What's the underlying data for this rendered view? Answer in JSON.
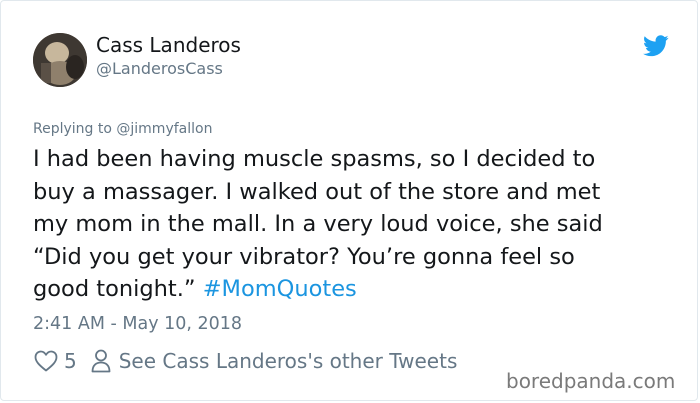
{
  "tweet": {
    "user": {
      "display_name": "Cass Landeros",
      "handle": "@LanderosCass"
    },
    "reply": {
      "prefix": "Replying to ",
      "mention": "@jimmyfallon"
    },
    "text_lines": [
      "I had been having muscle spasms, so I decided to",
      "buy a massager.  I walked out of the store and met",
      "my mom in the mall.  In a very loud voice, she said",
      "“Did you get your vibrator? You’re gonna feel so",
      "good tonight.” "
    ],
    "hashtag": "#MomQuotes",
    "timestamp": "2:41 AM - May 10, 2018",
    "likes": "5",
    "other_tweets_label": "See Cass Landeros's other Tweets"
  },
  "watermark": "boredpanda.com",
  "colors": {
    "link": "#1b95e0",
    "secondary": "#657786",
    "border": "#e1e8ed"
  },
  "icons": {
    "brand": "twitter-bird-icon",
    "like": "heart-icon",
    "profile": "person-icon"
  }
}
